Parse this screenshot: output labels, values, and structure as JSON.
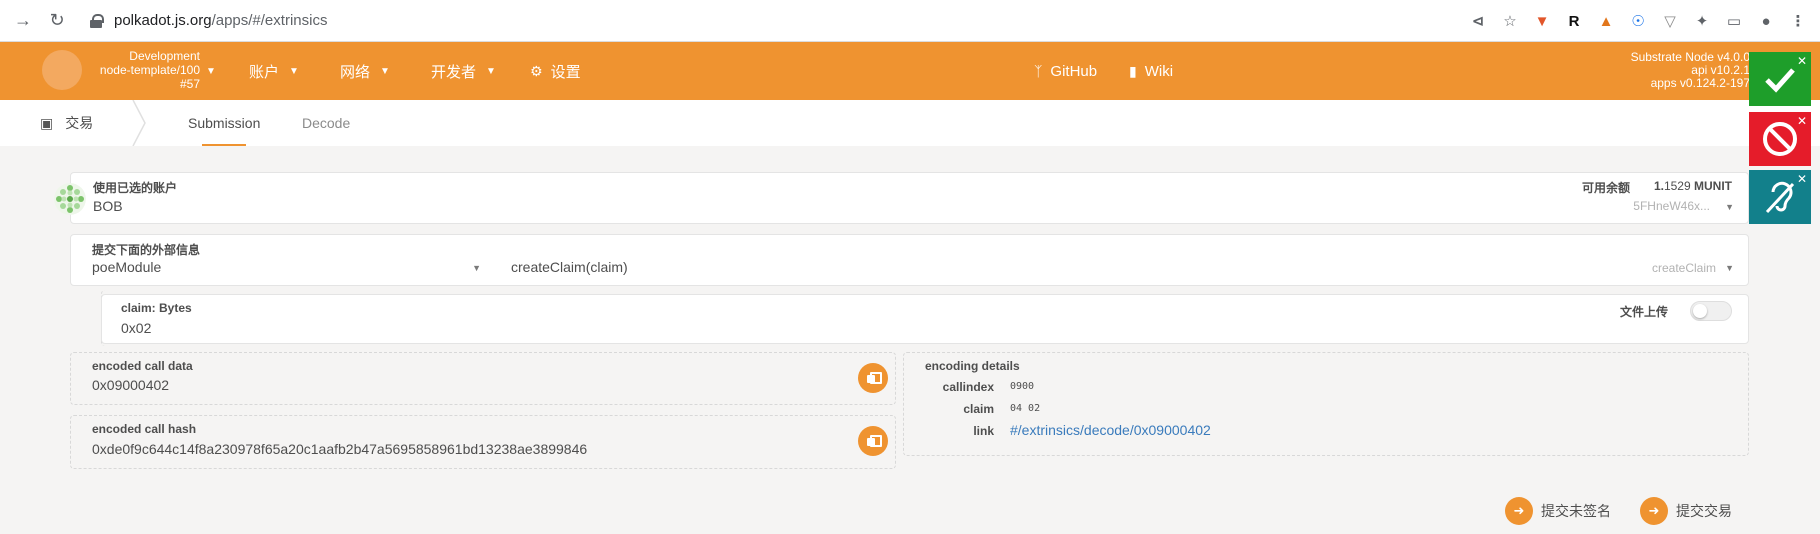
{
  "browser": {
    "url_host": "polkadot.js.org",
    "url_path": "/apps/#/extrinsics"
  },
  "header": {
    "chain_lines": [
      "Development",
      "node-template/100",
      "#57"
    ],
    "menu": [
      {
        "label": "账户",
        "icon": "user-icon"
      },
      {
        "label": "网络",
        "icon": "network-icon"
      },
      {
        "label": "开发者",
        "icon": "code-icon"
      },
      {
        "label": "设置",
        "icon": "gear-icon"
      }
    ],
    "github_label": "GitHub",
    "wiki_label": "Wiki",
    "version_lines": [
      "Substrate Node v4.0.0",
      "api v10.2.1",
      "apps v0.124.2-197"
    ]
  },
  "subheader": {
    "section_title": "交易",
    "tabs": [
      "Submission",
      "Decode"
    ]
  },
  "account": {
    "label": "使用已选的账户",
    "name": "BOB",
    "balance_label": "可用余额",
    "balance_int": "1.",
    "balance_frac": "1529",
    "balance_unit": "MUNIT",
    "address_short": "5FHneW46x..."
  },
  "extrinsic": {
    "label": "提交下面的外部信息",
    "module": "poeModule",
    "call": "createClaim(claim)",
    "call_hint": "createClaim"
  },
  "param": {
    "label": "claim: Bytes",
    "value": "0x02",
    "file_upload_label": "文件上传"
  },
  "encoded": {
    "call_data_label": "encoded call data",
    "call_data": "0x09000402",
    "call_hash_label": "encoded call hash",
    "call_hash": "0xde0f9c644c14f8a230978f65a20c1aafb2b47a5695858961bd13238ae3899846"
  },
  "details": {
    "title": "encoding details",
    "callindex_label": "callindex",
    "callindex": "0900",
    "claim_label": "claim",
    "claim": "04 02",
    "link_label": "link",
    "link": "#/extrinsics/decode/0x09000402"
  },
  "actions": {
    "submit_unsigned": "提交未签名",
    "submit": "提交交易"
  },
  "colors": {
    "brand": "#ef9330",
    "status_ok": "#1e9e2a",
    "status_block": "#e51c2a",
    "status_access": "#12808b"
  }
}
